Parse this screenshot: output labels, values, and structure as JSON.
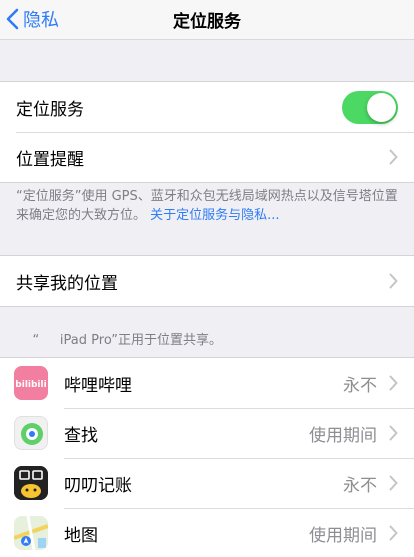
{
  "nav": {
    "back_label": "隐私",
    "title": "定位服务"
  },
  "location_group": {
    "toggle_label": "定位服务",
    "toggle_on": true,
    "alerts_label": "位置提醒"
  },
  "footnote_location": {
    "text": "“定位服务”使用 GPS、蓝牙和众包无线局域网热点以及信号塔位置来确定您的大致方位。",
    "link": "关于定位服务与隐私..."
  },
  "share_group": {
    "label": "共享我的位置"
  },
  "footnote_share": {
    "text": "“     iPad Pro”正用于位置共享。"
  },
  "apps": [
    {
      "name": "哔哩哔哩",
      "value": "永不",
      "icon": "bilibili-app-icon"
    },
    {
      "name": "查找",
      "value": "使用期间",
      "icon": "find-my-app-icon"
    },
    {
      "name": "叨叨记账",
      "value": "永不",
      "icon": "daodao-app-icon"
    },
    {
      "name": "地图",
      "value": "使用期间",
      "icon": "maps-app-icon"
    }
  ],
  "colors": {
    "accent": "#2f7cf6",
    "toggle_on": "#4bd863",
    "background": "#efeff4",
    "secondary_text": "#8e8e93"
  }
}
